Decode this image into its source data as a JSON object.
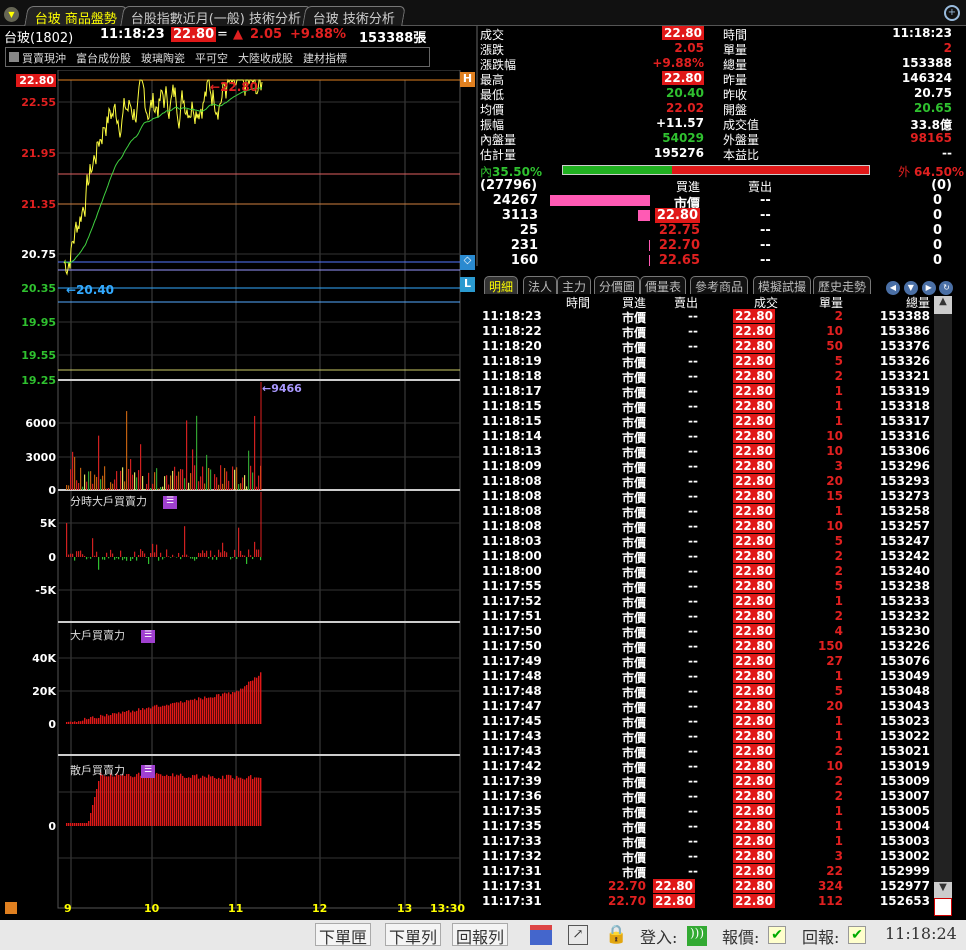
{
  "tabs": [
    "台玻 商品盤勢",
    "台股指數近月(一般) 技術分析",
    "台玻 技術分析"
  ],
  "header": {
    "name": "台玻(1802)",
    "time": "11:18:23",
    "price": "22.80",
    "flat": "=",
    "change": "2.05",
    "pct": "+9.88%",
    "volume": "153388張"
  },
  "tags": [
    "買賣現沖",
    "富台成份股",
    "玻璃陶瓷",
    "平可空",
    "大陸收成股",
    "建材指標"
  ],
  "price_axis": [
    "22.80",
    "22.55",
    "21.95",
    "21.35",
    "20.75",
    "20.35",
    "19.95",
    "19.55",
    "19.25"
  ],
  "markers": {
    "high": "H",
    "low": "L",
    "high_label": "22.80",
    "low_label": "20.40",
    "vol_peak": "9466"
  },
  "vol_axis": [
    "6000",
    "3000",
    "0"
  ],
  "panel2": {
    "title": "分時大戶買賣力",
    "axis": [
      "5K",
      "0",
      "-5K"
    ]
  },
  "panel3": {
    "title": "大戶買賣力",
    "axis": [
      "40K",
      "20K",
      "0"
    ]
  },
  "panel4": {
    "title": "散戶買賣力",
    "axis": [
      "0"
    ]
  },
  "time_axis": [
    "9",
    "10",
    "11",
    "12",
    "13",
    "13:30"
  ],
  "quote": {
    "left": [
      [
        "成交",
        "22.80"
      ],
      [
        "漲跌",
        "2.05"
      ],
      [
        "漲跌幅",
        "+9.88%"
      ],
      [
        "最高",
        "22.80"
      ],
      [
        "最低",
        "20.40"
      ],
      [
        "均價",
        "22.02"
      ],
      [
        "振幅",
        "+11.57"
      ],
      [
        "內盤量",
        "54029"
      ],
      [
        "估計量",
        "195276"
      ]
    ],
    "right": [
      [
        "時間",
        "11:18:23"
      ],
      [
        "單量",
        "2"
      ],
      [
        "總量",
        "153388"
      ],
      [
        "昨量",
        "146324"
      ],
      [
        "昨收",
        "20.75"
      ],
      [
        "開盤",
        "20.65"
      ],
      [
        "成交值",
        "33.8億"
      ],
      [
        "外盤量",
        "98165"
      ],
      [
        "本益比",
        "--"
      ]
    ]
  },
  "ratio": {
    "in_label": "內",
    "in_pct": "35.50%",
    "out_label": "外",
    "out_pct": "64.50%",
    "in_value": 35.5
  },
  "book": {
    "buy_total": "(27796)",
    "sell_total": "(0)",
    "buy_hdr": "買進",
    "sell_hdr": "賣出",
    "rows": [
      [
        "24267",
        "市價",
        "--",
        "0"
      ],
      [
        "3113",
        "22.80",
        "--",
        "0"
      ],
      [
        "25",
        "22.75",
        "--",
        "0"
      ],
      [
        "231",
        "22.70",
        "--",
        "0"
      ],
      [
        "160",
        "22.65",
        "--",
        "0"
      ]
    ]
  },
  "subtabs": [
    "明細",
    "法人",
    "主力",
    "分價圖",
    "價量表",
    "參考商品",
    "模擬試撮",
    "歷史走勢"
  ],
  "tick_headers": [
    "時間",
    "買進",
    "賣出",
    "成交",
    "單量",
    "總量"
  ],
  "ticks": [
    [
      "11:18:23",
      "市價",
      "--",
      "22.80",
      "2",
      "153388"
    ],
    [
      "11:18:22",
      "市價",
      "--",
      "22.80",
      "10",
      "153386"
    ],
    [
      "11:18:20",
      "市價",
      "--",
      "22.80",
      "50",
      "153376"
    ],
    [
      "11:18:19",
      "市價",
      "--",
      "22.80",
      "5",
      "153326"
    ],
    [
      "11:18:18",
      "市價",
      "--",
      "22.80",
      "2",
      "153321"
    ],
    [
      "11:18:17",
      "市價",
      "--",
      "22.80",
      "1",
      "153319"
    ],
    [
      "11:18:15",
      "市價",
      "--",
      "22.80",
      "1",
      "153318"
    ],
    [
      "11:18:15",
      "市價",
      "--",
      "22.80",
      "1",
      "153317"
    ],
    [
      "11:18:14",
      "市價",
      "--",
      "22.80",
      "10",
      "153316"
    ],
    [
      "11:18:13",
      "市價",
      "--",
      "22.80",
      "10",
      "153306"
    ],
    [
      "11:18:09",
      "市價",
      "--",
      "22.80",
      "3",
      "153296"
    ],
    [
      "11:18:08",
      "市價",
      "--",
      "22.80",
      "20",
      "153293"
    ],
    [
      "11:18:08",
      "市價",
      "--",
      "22.80",
      "15",
      "153273"
    ],
    [
      "11:18:08",
      "市價",
      "--",
      "22.80",
      "1",
      "153258"
    ],
    [
      "11:18:08",
      "市價",
      "--",
      "22.80",
      "10",
      "153257"
    ],
    [
      "11:18:03",
      "市價",
      "--",
      "22.80",
      "5",
      "153247"
    ],
    [
      "11:18:00",
      "市價",
      "--",
      "22.80",
      "2",
      "153242"
    ],
    [
      "11:18:00",
      "市價",
      "--",
      "22.80",
      "2",
      "153240"
    ],
    [
      "11:17:55",
      "市價",
      "--",
      "22.80",
      "5",
      "153238"
    ],
    [
      "11:17:52",
      "市價",
      "--",
      "22.80",
      "1",
      "153233"
    ],
    [
      "11:17:51",
      "市價",
      "--",
      "22.80",
      "2",
      "153232"
    ],
    [
      "11:17:50",
      "市價",
      "--",
      "22.80",
      "4",
      "153230"
    ],
    [
      "11:17:50",
      "市價",
      "--",
      "22.80",
      "150",
      "153226"
    ],
    [
      "11:17:49",
      "市價",
      "--",
      "22.80",
      "27",
      "153076"
    ],
    [
      "11:17:48",
      "市價",
      "--",
      "22.80",
      "1",
      "153049"
    ],
    [
      "11:17:48",
      "市價",
      "--",
      "22.80",
      "5",
      "153048"
    ],
    [
      "11:17:47",
      "市價",
      "--",
      "22.80",
      "20",
      "153043"
    ],
    [
      "11:17:45",
      "市價",
      "--",
      "22.80",
      "1",
      "153023"
    ],
    [
      "11:17:43",
      "市價",
      "--",
      "22.80",
      "1",
      "153022"
    ],
    [
      "11:17:43",
      "市價",
      "--",
      "22.80",
      "2",
      "153021"
    ],
    [
      "11:17:42",
      "市價",
      "--",
      "22.80",
      "10",
      "153019"
    ],
    [
      "11:17:39",
      "市價",
      "--",
      "22.80",
      "2",
      "153009"
    ],
    [
      "11:17:36",
      "市價",
      "--",
      "22.80",
      "2",
      "153007"
    ],
    [
      "11:17:35",
      "市價",
      "--",
      "22.80",
      "1",
      "153005"
    ],
    [
      "11:17:35",
      "市價",
      "--",
      "22.80",
      "1",
      "153004"
    ],
    [
      "11:17:33",
      "市價",
      "--",
      "22.80",
      "1",
      "153003"
    ],
    [
      "11:17:32",
      "市價",
      "--",
      "22.80",
      "3",
      "153002"
    ],
    [
      "11:17:31",
      "市價",
      "--",
      "22.80",
      "22",
      "152999"
    ],
    [
      "11:17:31",
      "22.70",
      "22.80",
      "22.80",
      "324",
      "152977"
    ],
    [
      "11:17:31",
      "22.70",
      "22.80",
      "22.80",
      "112",
      "152653"
    ]
  ],
  "status": {
    "buttons": [
      "下單匣",
      "下單列",
      "回報列"
    ],
    "login": "登入:",
    "quote": "報價:",
    "report": "回報:",
    "check": "✔",
    "time": "11:18:24"
  },
  "colors": {
    "up": "#e02020",
    "down": "#2fc12f",
    "accent": "#ffff00"
  }
}
